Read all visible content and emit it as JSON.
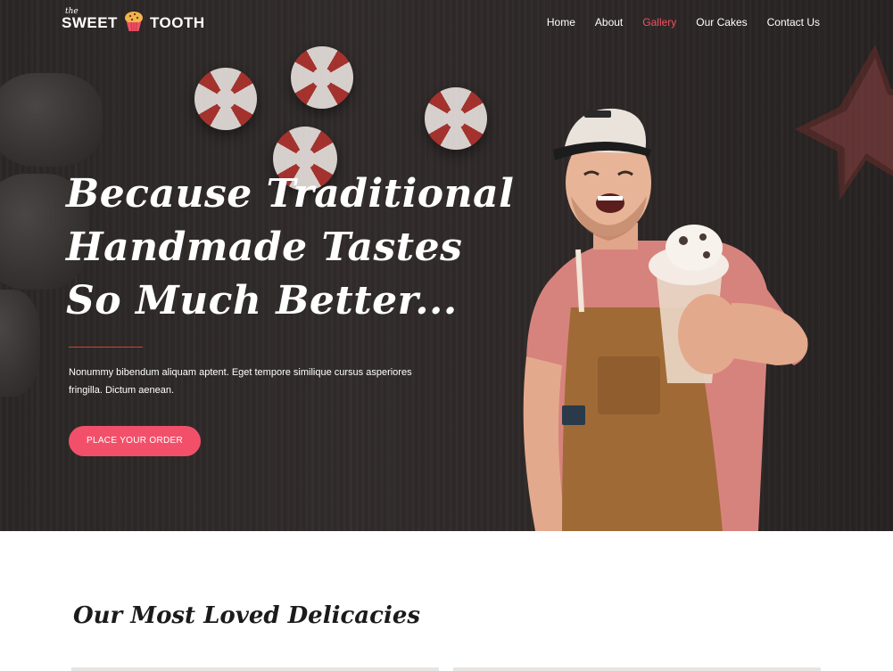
{
  "brand": {
    "prefix": "the",
    "word1": "SWEET",
    "word2": "TOOTH"
  },
  "nav": [
    {
      "label": "Home",
      "active": false
    },
    {
      "label": "About",
      "active": false
    },
    {
      "label": "Gallery",
      "active": true
    },
    {
      "label": "Our Cakes",
      "active": false
    },
    {
      "label": "Contact Us",
      "active": false
    }
  ],
  "hero": {
    "headline_lines": [
      "Because Traditional",
      "Handmade Tastes",
      "So Much Better..."
    ],
    "description": "Nonummy bibendum aliquam aptent. Eget tempore similique cursus asperiores fringilla. Dictum aenean.",
    "cta_label": "PLACE YOUR ORDER"
  },
  "section": {
    "title": "Our Most Loved Delicacies"
  },
  "colors": {
    "accent": "#f25063",
    "hero_bg": "#2d2827",
    "text_light": "#ffffff"
  },
  "icons": {
    "logo": "cupcake-icon"
  }
}
